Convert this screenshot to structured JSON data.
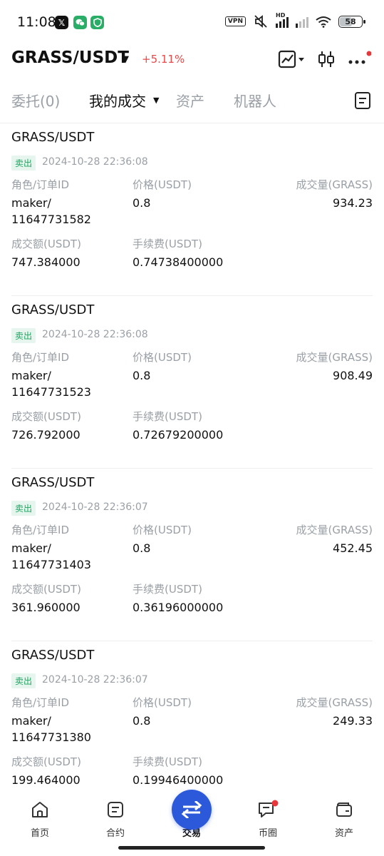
{
  "status_bar": {
    "time": "11:08",
    "vpn": "VPN",
    "network": "HD",
    "battery": "58",
    "battery_level_percent": 58
  },
  "header": {
    "pair": "GRASS/USDT",
    "change": "+5.11%",
    "change_color": "#e8494a",
    "icons": [
      "chart-trend-icon",
      "candlestick-icon",
      "more-icon"
    ]
  },
  "tabs": [
    {
      "label": "委托(0)",
      "active": false
    },
    {
      "label": "我的成交",
      "active": true
    },
    {
      "label": "资产",
      "active": false
    },
    {
      "label": "机器人",
      "active": false
    }
  ],
  "labels": {
    "role": "角色/订单ID",
    "price": "价格(USDT)",
    "volume": "成交量(GRASS)",
    "amount": "成交额(USDT)",
    "fee": "手续费(USDT)"
  },
  "trades": [
    {
      "pair": "GRASS/USDT",
      "side": "卖出",
      "time": "2024-10-28 22:36:08",
      "role": "maker/",
      "order_id": "11647731582",
      "price": "0.8",
      "volume": "934.23",
      "amount": "747.384000",
      "fee": "0.74738400000"
    },
    {
      "pair": "GRASS/USDT",
      "side": "卖出",
      "time": "2024-10-28 22:36:08",
      "role": "maker/",
      "order_id": "11647731523",
      "price": "0.8",
      "volume": "908.49",
      "amount": "726.792000",
      "fee": "0.72679200000"
    },
    {
      "pair": "GRASS/USDT",
      "side": "卖出",
      "time": "2024-10-28 22:36:07",
      "role": "maker/",
      "order_id": "11647731403",
      "price": "0.8",
      "volume": "452.45",
      "amount": "361.960000",
      "fee": "0.36196000000"
    },
    {
      "pair": "GRASS/USDT",
      "side": "卖出",
      "time": "2024-10-28 22:36:07",
      "role": "maker/",
      "order_id": "11647731380",
      "price": "0.8",
      "volume": "249.33",
      "amount": "199.464000",
      "fee": "0.19946400000"
    }
  ],
  "bottom_nav": [
    {
      "label": "首页",
      "icon": "home-icon"
    },
    {
      "label": "合约",
      "icon": "contract-icon"
    },
    {
      "label": "交易",
      "icon": "swap-icon",
      "active": true
    },
    {
      "label": "币圈",
      "icon": "chat-icon",
      "badge": true
    },
    {
      "label": "资产",
      "icon": "wallet-icon"
    }
  ],
  "colors": {
    "sell_green": "#1ea361",
    "accent_blue": "#2b59d9",
    "notification_red": "#e8373b"
  }
}
